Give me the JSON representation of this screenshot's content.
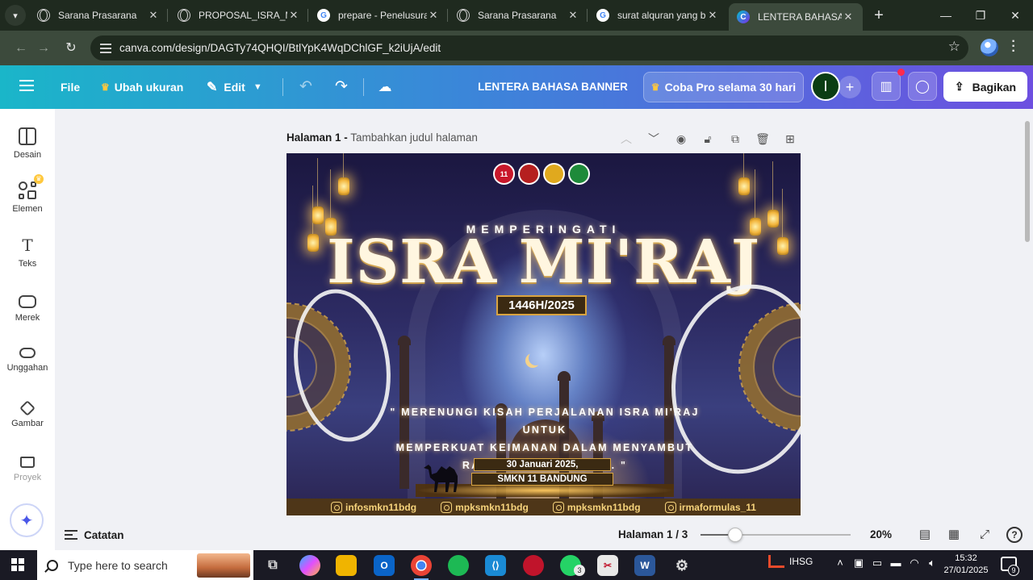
{
  "browser": {
    "tabs": [
      {
        "title": "Sarana Prasarana",
        "icon": "globe-icon",
        "active": false
      },
      {
        "title": "PROPOSAL_ISRA_MI",
        "icon": "globe-icon",
        "active": false
      },
      {
        "title": "prepare - Penelusuran",
        "icon": "google-icon",
        "active": false
      },
      {
        "title": "Sarana Prasarana",
        "icon": "globe-icon",
        "active": false
      },
      {
        "title": "surat alquran yang b",
        "icon": "google-icon",
        "active": false
      },
      {
        "title": "LENTERA BAHASA BA",
        "icon": "canva-icon",
        "active": true
      }
    ],
    "url": "canva.com/design/DAGTy74QHQI/BtlYpK4WqDChlGF_k2iUjA/edit"
  },
  "canva": {
    "header": {
      "file": "File",
      "resize": "Ubah ukuran",
      "edit": "Edit",
      "doc_title": "LENTERA BAHASA BANNER",
      "pro_trial": "Coba Pro selama 30 hari",
      "avatar_initial": "I",
      "share": "Bagikan"
    },
    "sidebar": [
      {
        "label": "Desain",
        "icon": "layout-icon"
      },
      {
        "label": "Elemen",
        "icon": "shapes-icon"
      },
      {
        "label": "Teks",
        "icon": "text-icon"
      },
      {
        "label": "Merek",
        "icon": "brand-icon"
      },
      {
        "label": "Unggahan",
        "icon": "upload-cloud-icon"
      },
      {
        "label": "Gambar",
        "icon": "draw-pen-icon"
      },
      {
        "label": "Proyek",
        "icon": "folder-icon"
      }
    ],
    "page_header": {
      "page_label": "Halaman 1 -",
      "add_title": "Tambahkan judul halaman"
    },
    "design": {
      "logos": [
        "11",
        "",
        "",
        ""
      ],
      "kicker": "MEMPERINGATI",
      "title": "ISRA MI'RAJ",
      "year": "1446H/2025",
      "quote_line1": "\" MERENUNGI KISAH PERJALANAN ISRA MI'RAJ UNTUK",
      "quote_line2": "MEMPERKUAT KEIMANAN DALAM MENYAMBUT",
      "quote_line3": "RAMADHAN YANG SUCI. \"",
      "date": "30 Januari 2025,",
      "school": "SMKN 11 BANDUNG",
      "handles": [
        "infosmkn11bdg",
        "mpksmkn11bdg",
        "mpksmkn11bdg",
        "irmaformulas_11"
      ]
    },
    "footer": {
      "notes": "Catatan",
      "page_indicator": "Halaman 1 / 3",
      "zoom": "20%",
      "zoom_fraction": 0.2,
      "help": "?"
    },
    "colors": {
      "header_gradient_start": "#1ab6c9",
      "header_gradient_end": "#6d4fe0",
      "design_footer": "#4e3618",
      "gold": "#d9a441"
    }
  },
  "taskbar": {
    "search_placeholder": "Type here to search",
    "whatsapp_badge": "3",
    "stock_ticker": "IHSG",
    "time": "15:32",
    "date": "27/01/2025",
    "notification_count": "9"
  }
}
